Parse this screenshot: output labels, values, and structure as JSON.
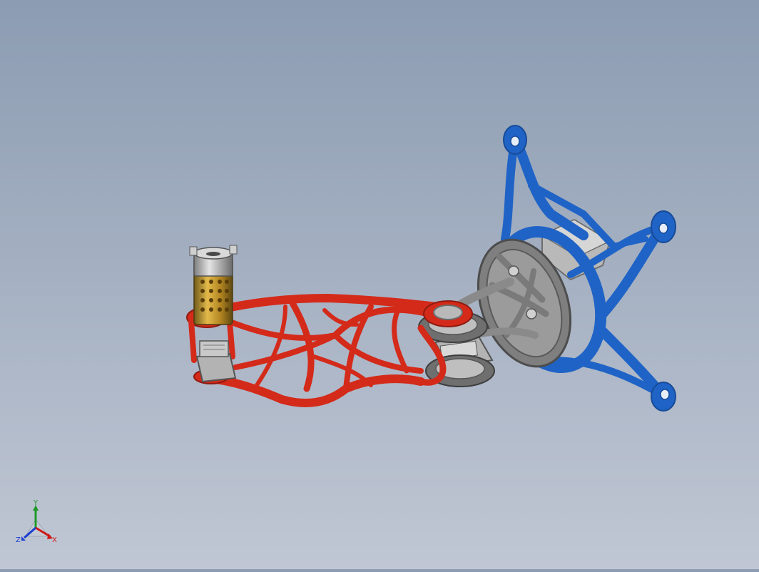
{
  "viewport": {
    "colors": {
      "background_top": "#8c9cb2",
      "background_bottom": "#c0c7d4",
      "red_part": "#d42a1a",
      "blue_part": "#1f63c6",
      "gray_part": "#8e8e8e",
      "motor_gold": "#c89b2a"
    }
  },
  "triad": {
    "x_label": "X",
    "y_label": "Y",
    "z_label": "Z",
    "x_color": "#d01818",
    "y_color": "#1f9a2a",
    "z_color": "#1a3fd0"
  }
}
